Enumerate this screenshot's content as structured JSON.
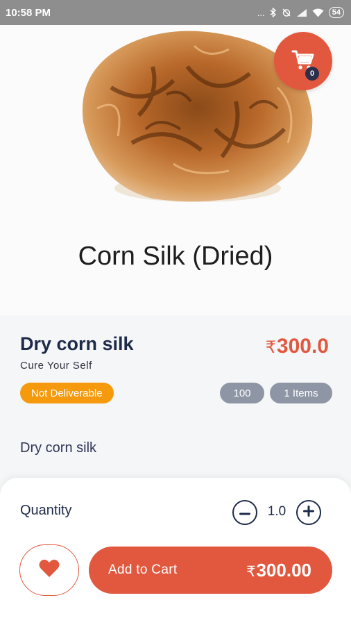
{
  "status_bar": {
    "time": "10:58 PM",
    "dots": "...",
    "battery": "54"
  },
  "cart": {
    "count": "0"
  },
  "hero": {
    "title": "Corn Silk (Dried)"
  },
  "product": {
    "name": "Dry corn silk",
    "seller": "Cure Your Self",
    "currency_symbol": "₹",
    "price": "300.0",
    "delivery_badge": "Not Deliverable",
    "stock": "100",
    "items": "1 Items",
    "description": "Dry corn silk"
  },
  "order": {
    "quantity_label": "Quantity",
    "quantity_value": "1.0",
    "add_to_cart_label": "Add to Cart",
    "total_currency": "₹",
    "total": "300.00"
  },
  "colors": {
    "accent": "#e2583e",
    "navy": "#1e2a4a",
    "warning": "#f59a0c",
    "muted_pill": "#8e96a5"
  },
  "icons": {
    "cart": "cart-icon",
    "favorite": "heart-icon",
    "minus": "minus-circle-icon",
    "plus": "plus-circle-icon"
  }
}
